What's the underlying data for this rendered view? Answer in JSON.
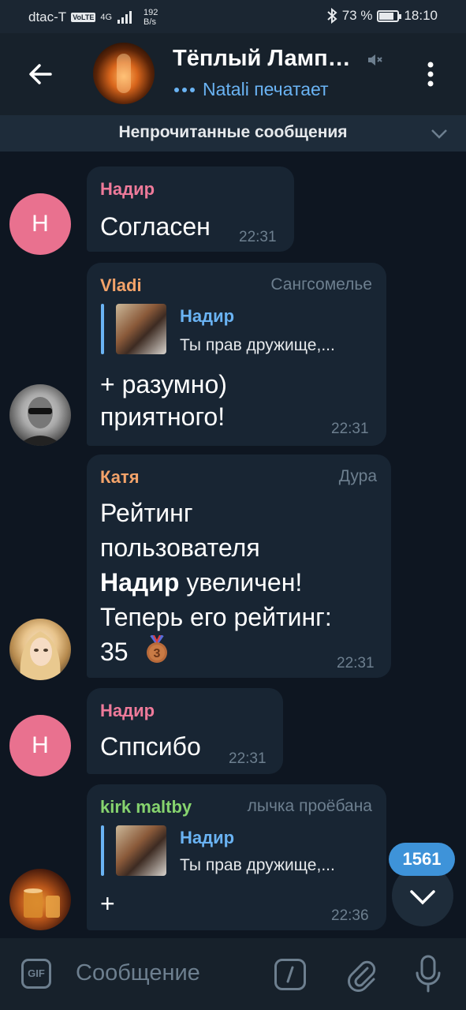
{
  "statusbar": {
    "carrier": "dtac-T",
    "volte": "VoLTE",
    "network": "4G",
    "speed_value": "192",
    "speed_unit": "B/s",
    "battery": "73 %",
    "battery_level": 0.73,
    "time": "18:10"
  },
  "header": {
    "title": "Тёплый Ламп…",
    "typing": "Natali печатает",
    "avatar_icon": "vacuum-tube-photo",
    "muted_icon": "mute-icon"
  },
  "unread_banner": {
    "label": "Непрочитанные сообщения"
  },
  "messages": [
    {
      "sender": "Надир",
      "sender_color": "#ee7a9a",
      "avatar_letter": "Н",
      "avatar_color": "#e9718f",
      "text": "Согласен",
      "time": "22:31"
    },
    {
      "sender": "Vladi",
      "sender_color": "#f3a36a",
      "role": "Сангсомелье",
      "reply": {
        "name": "Надир",
        "text": "Ты прав дружище,..."
      },
      "text_line1": "+ разумно)",
      "text_line2": "приятного!",
      "time": "22:31"
    },
    {
      "sender": "Катя",
      "sender_color": "#f3a36a",
      "role": "Дура",
      "line1": "Рейтинг",
      "line2": "пользователя",
      "line3_bold": "Надир",
      "line3_rest": " увеличен!",
      "line4": "Теперь его рейтинг:",
      "line5": "35",
      "medal_number": "3",
      "time": "22:31"
    },
    {
      "sender": "Надир",
      "sender_color": "#ee7a9a",
      "avatar_letter": "Н",
      "text": "Сппсибо",
      "time": "22:31"
    },
    {
      "sender": "kirk maltby",
      "sender_color": "#86d36e",
      "role": "лычка проёбана",
      "reply": {
        "name": "Надир",
        "text": "Ты прав дружище,..."
      },
      "text": "+",
      "time": "22:36"
    }
  ],
  "scroll": {
    "unread_count": "1561"
  },
  "input": {
    "gif_label": "GIF",
    "placeholder": "Сообщение"
  },
  "colors": {
    "background": "#0e1621",
    "bubble": "#182533",
    "header": "#17212b",
    "accent": "#6ab3f3",
    "badge": "#3e93d9"
  }
}
